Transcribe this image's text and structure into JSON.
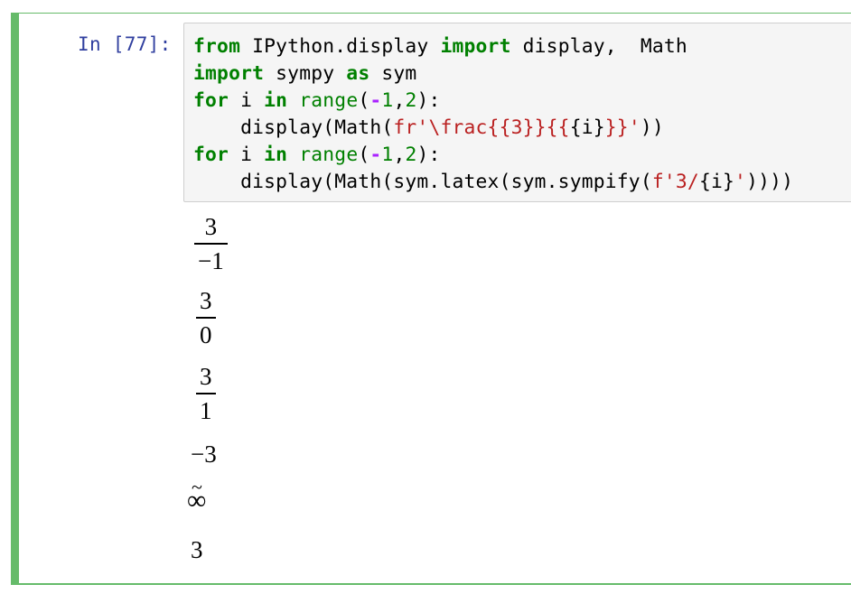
{
  "cell": {
    "prompt": "In [77]:",
    "accent_color": "#66bb6a",
    "code_lines": [
      [
        {
          "t": "from",
          "c": "kw"
        },
        {
          "t": " IPython.display ",
          "c": ""
        },
        {
          "t": "import",
          "c": "kw"
        },
        {
          "t": " display,  Math",
          "c": ""
        }
      ],
      [
        {
          "t": "import",
          "c": "kw"
        },
        {
          "t": " sympy ",
          "c": ""
        },
        {
          "t": "as",
          "c": "kw"
        },
        {
          "t": " sym",
          "c": ""
        }
      ],
      [
        {
          "t": "for",
          "c": "kw"
        },
        {
          "t": " i ",
          "c": ""
        },
        {
          "t": "in",
          "c": "kw"
        },
        {
          "t": " ",
          "c": ""
        },
        {
          "t": "range",
          "c": "bi"
        },
        {
          "t": "(",
          "c": ""
        },
        {
          "t": "-",
          "c": "op"
        },
        {
          "t": "1",
          "c": "num"
        },
        {
          "t": ",",
          "c": ""
        },
        {
          "t": "2",
          "c": "num"
        },
        {
          "t": "):",
          "c": ""
        }
      ],
      [
        {
          "t": "    display(Math(",
          "c": ""
        },
        {
          "t": "fr'\\frac{{3}}{{",
          "c": "str"
        },
        {
          "t": "{i}",
          "c": ""
        },
        {
          "t": "}}'",
          "c": "str"
        },
        {
          "t": "))",
          "c": ""
        }
      ],
      [
        {
          "t": "for",
          "c": "kw"
        },
        {
          "t": " i ",
          "c": ""
        },
        {
          "t": "in",
          "c": "kw"
        },
        {
          "t": " ",
          "c": ""
        },
        {
          "t": "range",
          "c": "bi"
        },
        {
          "t": "(",
          "c": ""
        },
        {
          "t": "-",
          "c": "op"
        },
        {
          "t": "1",
          "c": "num"
        },
        {
          "t": ",",
          "c": ""
        },
        {
          "t": "2",
          "c": "num"
        },
        {
          "t": "):",
          "c": ""
        }
      ],
      [
        {
          "t": "    display(Math(sym.latex(sym.sympify(",
          "c": ""
        },
        {
          "t": "f'3/",
          "c": "str"
        },
        {
          "t": "{i}",
          "c": ""
        },
        {
          "t": "'",
          "c": "str"
        },
        {
          "t": "))))",
          "c": ""
        }
      ]
    ],
    "outputs": [
      {
        "type": "frac",
        "num": "3",
        "den": "−1"
      },
      {
        "type": "frac",
        "num": "3",
        "den": "0"
      },
      {
        "type": "frac",
        "num": "3",
        "den": "1"
      },
      {
        "type": "plain",
        "text": "−3"
      },
      {
        "type": "complex-infinity",
        "text": "∞",
        "tilde": "~"
      },
      {
        "type": "plain",
        "text": "3"
      }
    ]
  }
}
